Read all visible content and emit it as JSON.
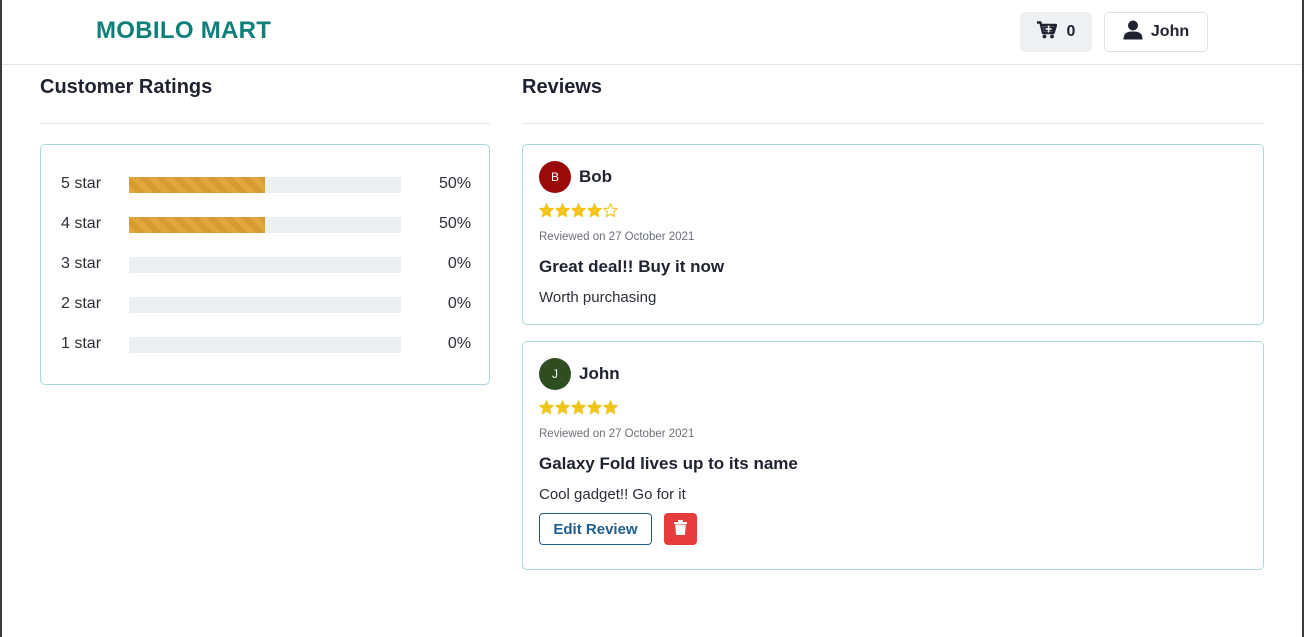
{
  "header": {
    "brand": "MOBILO MART",
    "cart_count": "0",
    "user_name": "John",
    "cart_icon": "cart-icon",
    "user_icon": "user-icon"
  },
  "ratings": {
    "title": "Customer Ratings",
    "rows": [
      {
        "label": "5 star",
        "percent_text": "50%",
        "percent": 50
      },
      {
        "label": "4 star",
        "percent_text": "50%",
        "percent": 50
      },
      {
        "label": "3 star",
        "percent_text": "0%",
        "percent": 0
      },
      {
        "label": "2 star",
        "percent_text": "0%",
        "percent": 0
      },
      {
        "label": "1 star",
        "percent_text": "0%",
        "percent": 0
      }
    ],
    "bar_color": "#e2a63e"
  },
  "reviews": {
    "title": "Reviews",
    "items": [
      {
        "initial": "B",
        "name": "Bob",
        "avatar_color": "#9b0a0a",
        "stars": 4,
        "date": "Reviewed on 27 October 2021",
        "title": "Great deal!! Buy it now",
        "body": "Worth purchasing"
      },
      {
        "initial": "J",
        "name": "John",
        "avatar_color": "#2e4e22",
        "stars": 5,
        "date": "Reviewed on 27 October 2021",
        "title": "Galaxy Fold lives up to its name",
        "body": "Cool gadget!! Go for it",
        "edit_label": "Edit Review",
        "delete_icon": "trash-icon"
      }
    ],
    "star_color": "#f0c419"
  }
}
